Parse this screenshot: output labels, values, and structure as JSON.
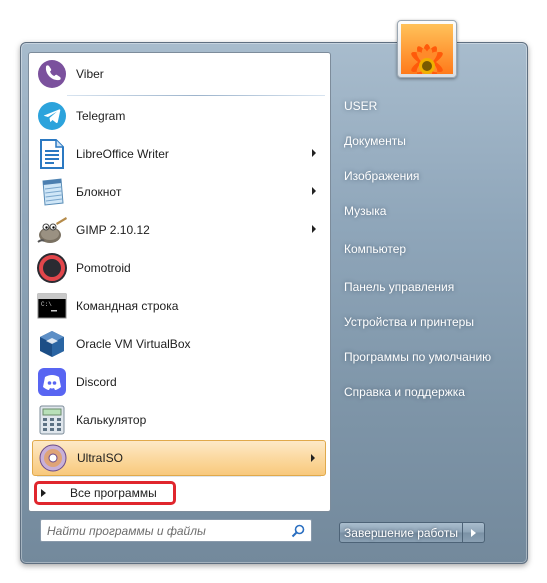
{
  "programs": [
    {
      "label": "Viber",
      "icon": "viber-icon",
      "submenu": false
    },
    {
      "label": "Telegram",
      "icon": "telegram-icon",
      "submenu": false
    },
    {
      "label": "LibreOffice Writer",
      "icon": "libreoffice-writer-icon",
      "submenu": true
    },
    {
      "label": "Блокнот",
      "icon": "notepad-icon",
      "submenu": true
    },
    {
      "label": "GIMP 2.10.12",
      "icon": "gimp-icon",
      "submenu": true
    },
    {
      "label": "Pomotroid",
      "icon": "pomotroid-icon",
      "submenu": false
    },
    {
      "label": "Командная строка",
      "icon": "command-prompt-icon",
      "submenu": false
    },
    {
      "label": "Oracle VM VirtualBox",
      "icon": "virtualbox-icon",
      "submenu": false
    },
    {
      "label": "Discord",
      "icon": "discord-icon",
      "submenu": false
    },
    {
      "label": "Калькулятор",
      "icon": "calculator-icon",
      "submenu": false
    },
    {
      "label": "UltraISO",
      "icon": "ultraiso-icon",
      "submenu": true,
      "highlighted": true
    }
  ],
  "all_programs": {
    "label": "Все программы",
    "highlight_color": "#e0262d"
  },
  "search": {
    "placeholder": "Найти программы и файлы",
    "value": ""
  },
  "right_pane": {
    "user": "USER",
    "items": [
      "Документы",
      "Изображения",
      "Музыка",
      "Компьютер",
      "Панель управления",
      "Устройства и принтеры",
      "Программы по умолчанию",
      "Справка и поддержка"
    ]
  },
  "shutdown": {
    "label": "Завершение работы"
  },
  "colors": {
    "accent_highlight": "#fbd9a0",
    "menu_background": "#8fa6ba"
  }
}
